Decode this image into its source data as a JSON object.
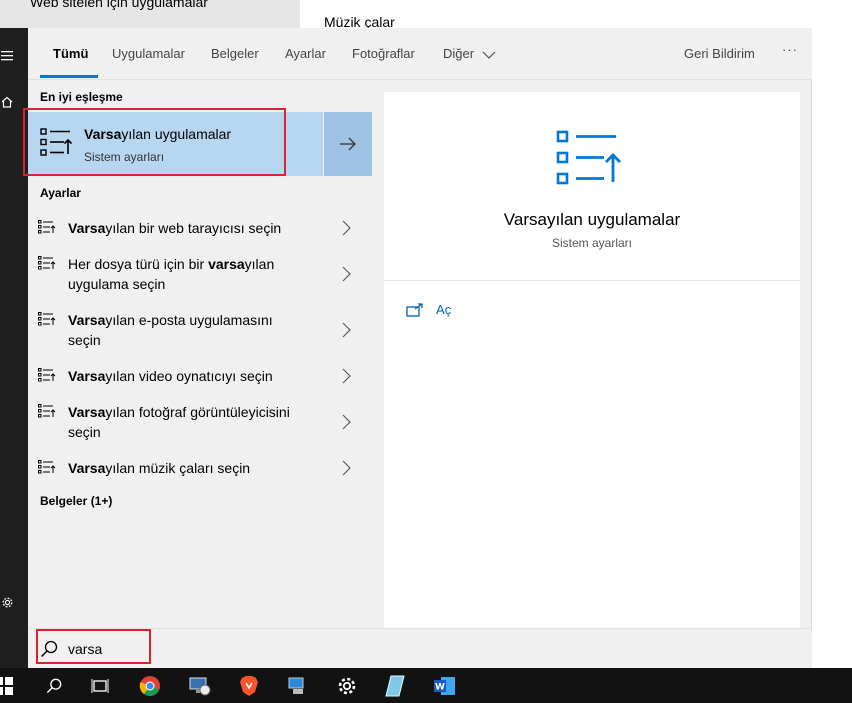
{
  "background": {
    "top_left_text": "Web sitelen için uygulamalar",
    "music_text": "Müzik çalar"
  },
  "tabs": {
    "all": "Tümü",
    "apps": "Uygulamalar",
    "documents": "Belgeler",
    "settings": "Ayarlar",
    "photos": "Fotoğraflar",
    "more": "Diğer",
    "feedback": "Geri Bildirim",
    "ellipsis": "···"
  },
  "results": {
    "best_match_title": "En iyi eşleşme",
    "best": {
      "title_bold": "Varsa",
      "title_rest": "yılan uygulamalar",
      "subtitle": "Sistem ayarları"
    },
    "settings_title": "Ayarlar",
    "items": [
      {
        "pre": "",
        "bold": "Varsa",
        "post": "yılan bir web tarayıcısı seçin"
      },
      {
        "pre": "Her dosya türü için bir ",
        "bold": "varsa",
        "post": "yılan uygulama seçin"
      },
      {
        "pre": "",
        "bold": "Varsa",
        "post": "yılan e-posta uygulamasını seçin"
      },
      {
        "pre": "",
        "bold": "Varsa",
        "post": "yılan video oynatıcıyı seçin"
      },
      {
        "pre": "",
        "bold": "Varsa",
        "post": "yılan fotoğraf görüntüleyicisini seçin"
      },
      {
        "pre": "",
        "bold": "Varsa",
        "post": "yılan müzik çaları seçin"
      }
    ],
    "documents_title": "Belgeler (1+)"
  },
  "preview": {
    "title": "Varsayılan uygulamalar",
    "subtitle": "Sistem ayarları",
    "open_label": "Aç"
  },
  "search": {
    "query": "varsa"
  },
  "taskbar": {
    "icons": [
      "windows-start",
      "search",
      "task-view",
      "chrome",
      "remote-desktop",
      "brave",
      "network-computer",
      "settings",
      "notepad",
      "word"
    ]
  },
  "colors": {
    "accent": "#0078d7",
    "selection": "#b7d6f0",
    "highlight_box": "#d9232d"
  }
}
